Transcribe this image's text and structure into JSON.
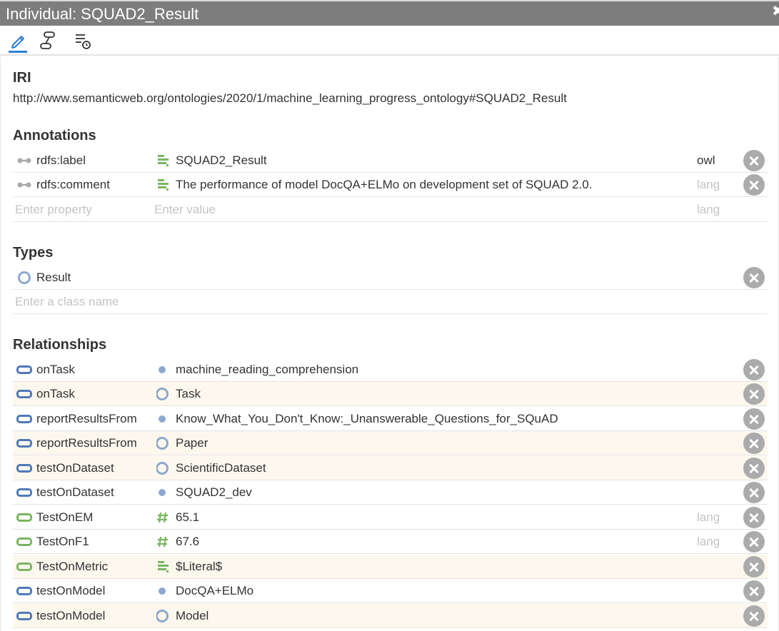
{
  "window": {
    "title": "Individual: SQUAD2_Result",
    "close_glyph": "✖"
  },
  "toolbar": {
    "tools": [
      {
        "name": "edit-icon",
        "active": true
      },
      {
        "name": "relationship-icon",
        "active": false
      },
      {
        "name": "list-settings-icon",
        "active": false
      }
    ]
  },
  "iri": {
    "heading": "IRI",
    "value": "http://www.semanticweb.org/ontologies/2020/1/machine_learning_progress_ontology#SQUAD2_Result"
  },
  "annotations": {
    "heading": "Annotations",
    "rows": [
      {
        "property": "rdfs:label",
        "value": "SQUAD2_Result",
        "lang": "owl"
      },
      {
        "property": "rdfs:comment",
        "value": "The performance of model DocQA+ELMo on development set of SQUAD 2.0.",
        "lang": "lang"
      }
    ],
    "new_row": {
      "property_placeholder": "Enter property",
      "value_placeholder": "Enter value",
      "lang_placeholder": "lang"
    }
  },
  "types": {
    "heading": "Types",
    "rows": [
      {
        "value": "Result"
      }
    ],
    "new_row": {
      "placeholder": "Enter a class name"
    }
  },
  "relationships": {
    "heading": "Relationships",
    "rows": [
      {
        "property": "onTask",
        "value": "machine_reading_comprehension",
        "lang": ""
      },
      {
        "property": "onTask",
        "value": "Task",
        "lang": ""
      },
      {
        "property": "reportResultsFrom",
        "value": "Know_What_You_Don't_Know:_Unanswerable_Questions_for_SQuAD",
        "lang": ""
      },
      {
        "property": "reportResultsFrom",
        "value": "Paper",
        "lang": ""
      },
      {
        "property": "testOnDataset",
        "value": "ScientificDataset",
        "lang": ""
      },
      {
        "property": "testOnDataset",
        "value": "SQUAD2_dev",
        "lang": ""
      },
      {
        "property": "TestOnEM",
        "value": "65.1",
        "lang": "lang"
      },
      {
        "property": "TestOnF1",
        "value": "67.6",
        "lang": "lang"
      },
      {
        "property": "TestOnMetric",
        "value": "$Literal$",
        "lang": ""
      },
      {
        "property": "testOnModel",
        "value": "DocQA+ELMo",
        "lang": ""
      },
      {
        "property": "testOnModel",
        "value": "Model",
        "lang": ""
      }
    ]
  },
  "colors": {
    "titlebar": "#7d7d7d",
    "accent": "#2f7fd6",
    "object_property": "#4f79b8",
    "data_property": "#79b561",
    "individual": "#8ea8cf",
    "delete_button": "#ababab",
    "highlight_row": "#fdf8ee"
  }
}
